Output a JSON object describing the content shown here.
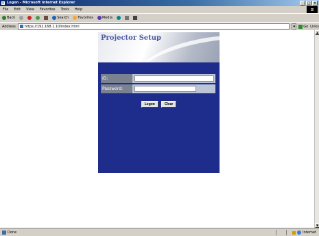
{
  "window": {
    "title": "Logon - Microsoft Internet Explorer",
    "min": "_",
    "max": "□",
    "close": "×"
  },
  "menu": [
    "File",
    "Edit",
    "View",
    "Favorites",
    "Tools",
    "Help"
  ],
  "toolbar": {
    "back": "Back",
    "search": "Search",
    "favorites": "Favorites",
    "media": "Media"
  },
  "address": {
    "label": "Address",
    "url": "https://192.168.1.10/index.html",
    "go": "Go",
    "links": "Links"
  },
  "page": {
    "title": "Projector Setup",
    "id_label": "ID:",
    "password_label": "Password:",
    "id_value": "",
    "password_value": "",
    "logon_label": "Logon",
    "clear_label": "Clear"
  },
  "status": {
    "text": "Done",
    "zone": "Internet"
  },
  "colors": {
    "panel": "#1e2c8c",
    "title_bar": "#0a246a",
    "chrome": "#d4d0c8"
  }
}
